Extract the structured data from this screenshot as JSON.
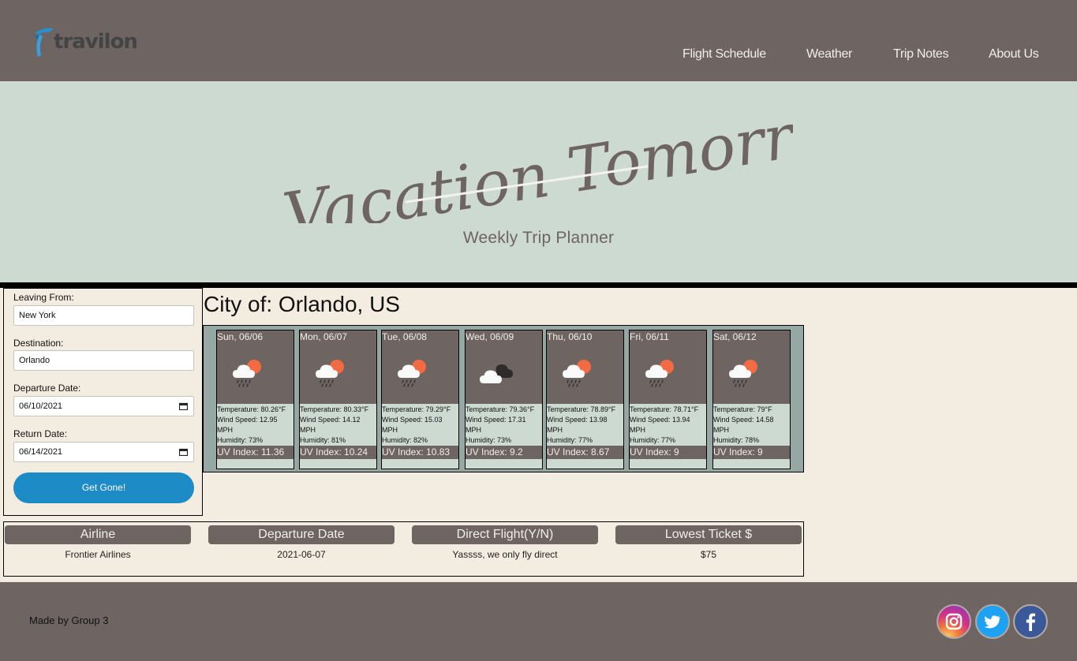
{
  "header": {
    "logo_text": "travilon",
    "nav": [
      "Flight Schedule",
      "Weather",
      "Trip Notes",
      "About Us"
    ]
  },
  "hero": {
    "title": "Vacation Tomorrow",
    "subtitle": "Weekly Trip Planner"
  },
  "form": {
    "leaving_label": "Leaving From:",
    "leaving_value": "New York",
    "destination_label": "Destination:",
    "destination_value": "Orlando",
    "departure_label": "Departure Date:",
    "departure_value": "06/10/2021",
    "return_label": "Return Date:",
    "return_value": "06/14/2021",
    "submit_label": "Get Gone!"
  },
  "weather": {
    "city_title": "City of: Orlando, US",
    "days": [
      {
        "date": "Sun, 06/06",
        "icon": "rain-sun",
        "temp": "Temperature: 80.26°F",
        "wind": "Wind Speed: 12.95 MPH",
        "humidity": "Humidity: 73%",
        "uv": "UV Index: 11.36"
      },
      {
        "date": "Mon, 06/07",
        "icon": "rain-sun",
        "temp": "Temperature: 80.33°F",
        "wind": "Wind Speed: 14.12 MPH",
        "humidity": "Humidity: 81%",
        "uv": "UV Index: 10.24"
      },
      {
        "date": "Tue, 06/08",
        "icon": "rain-sun",
        "temp": "Temperature: 79.29°F",
        "wind": "Wind Speed: 15.03 MPH",
        "humidity": "Humidity: 82%",
        "uv": "UV Index: 10.83"
      },
      {
        "date": "Wed, 06/09",
        "icon": "clouds",
        "temp": "Temperature: 79.36°F",
        "wind": "Wind Speed: 17.31 MPH",
        "humidity": "Humidity: 73%",
        "uv": "UV Index: 9.2"
      },
      {
        "date": "Thu, 06/10",
        "icon": "rain-sun",
        "temp": "Temperature: 78.89°F",
        "wind": "Wind Speed: 13.98 MPH",
        "humidity": "Humidity: 77%",
        "uv": "UV Index: 8.67"
      },
      {
        "date": "Fri, 06/11",
        "icon": "rain-sun",
        "temp": "Temperature: 78.71°F",
        "wind": "Wind Speed: 13.94 MPH",
        "humidity": "Humidity: 77%",
        "uv": "UV Index: 9"
      },
      {
        "date": "Sat, 06/12",
        "icon": "rain-sun",
        "temp": "Temperature: 79°F",
        "wind": "Wind Speed: 14.58 MPH",
        "humidity": "Humidity: 78%",
        "uv": "UV Index: 9"
      }
    ]
  },
  "flights": {
    "headers": [
      "Airline",
      "Departure Date",
      "Direct Flight(Y/N)",
      "Lowest Ticket $"
    ],
    "row": [
      "Frontier Airlines",
      "2021-06-07",
      "Yassss, we only fly direct",
      "$75"
    ]
  },
  "footer": {
    "credit": "Made by Group 3",
    "social": [
      "instagram-icon",
      "twitter-icon",
      "facebook-icon"
    ]
  },
  "colors": {
    "header_bg": "#6e6462",
    "hero_bg": "#cddad1",
    "page_bg": "#f3ece0",
    "button_blue": "#1c8bc6",
    "forecast_bg": "#96a8a4"
  }
}
